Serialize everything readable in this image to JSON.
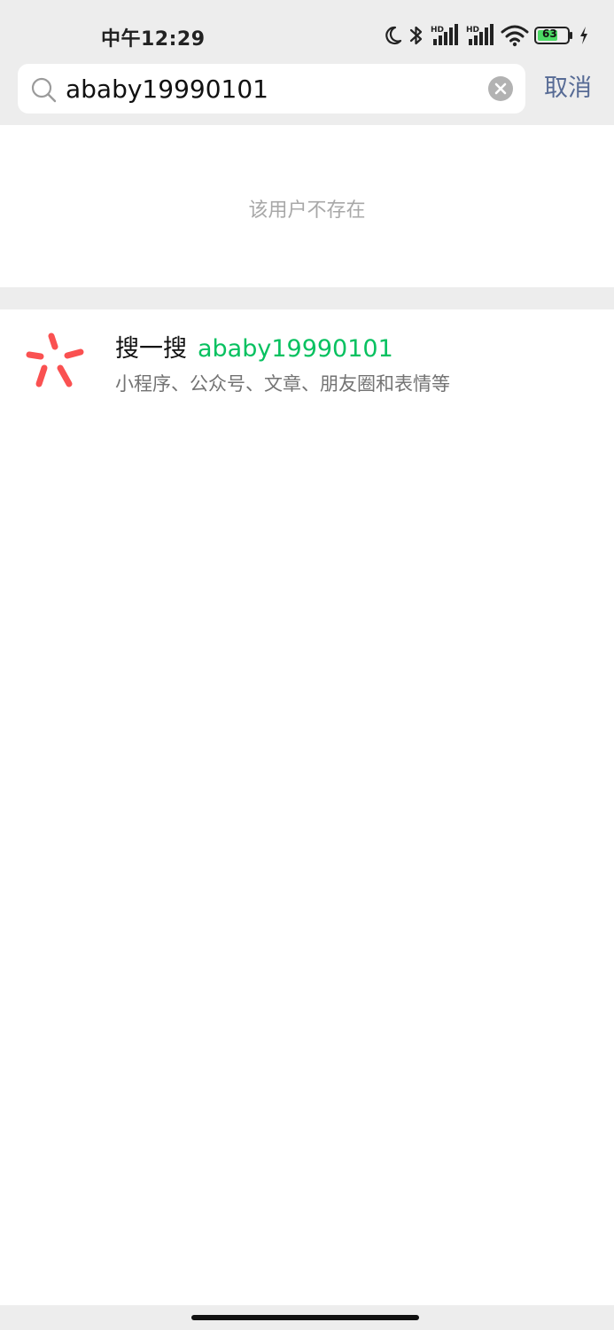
{
  "status_bar": {
    "time": "中午12:29",
    "battery_level": "63",
    "icons": [
      "moon-icon",
      "bluetooth-icon",
      "signal-hd-icon",
      "signal-hd-icon",
      "wifi-icon",
      "battery-icon",
      "charging-icon"
    ]
  },
  "search": {
    "value": "ababy19990101",
    "cancel_label": "取消"
  },
  "result": {
    "not_found_text": "该用户不存在"
  },
  "souyisou": {
    "title": "搜一搜",
    "keyword": "ababy19990101",
    "subtitle": "小程序、公众号、文章、朋友圈和表情等",
    "icon_color": "#fa5151",
    "keyword_color": "#07c160"
  },
  "colors": {
    "background": "#ededed",
    "cancel": "#576b95"
  }
}
